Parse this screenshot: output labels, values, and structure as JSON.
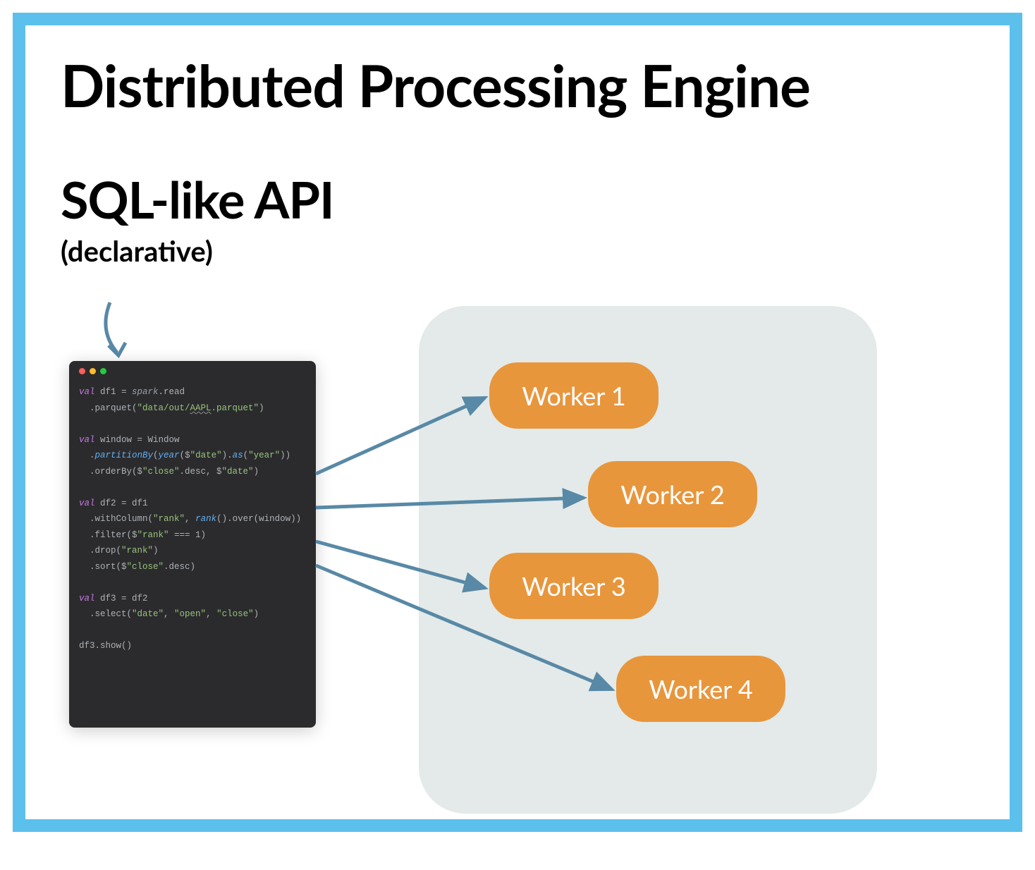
{
  "title": "Distributed Processing Engine",
  "subtitle": "SQL-like API",
  "subtitle_note": "(declarative)",
  "workers": [
    "Worker 1",
    "Worker 2",
    "Worker 3",
    "Worker 4"
  ],
  "code": {
    "l1_kw": "val",
    "l1_var": " df1 = ",
    "l1_id": "spark",
    "l1_rest": ".read",
    "l2_pre": "  .parquet(",
    "l2_str1": "\"data/out/",
    "l2_under": "AAPL",
    "l2_str2": ".parquet\"",
    "l2_post": ")",
    "l3_kw": "val",
    "l3_rest": " window = Window",
    "l4_pre": "  .",
    "l4_fn": "partitionBy",
    "l4_op": "(",
    "l4_fn2": "year",
    "l4_op2": "($",
    "l4_str": "\"date\"",
    "l4_mid": ").",
    "l4_fn3": "as",
    "l4_op3": "(",
    "l4_str2": "\"year\"",
    "l4_post": "))",
    "l5_pre": "  .orderBy($",
    "l5_str": "\"close\"",
    "l5_mid": ".desc, $",
    "l5_str2": "\"date\"",
    "l5_post": ")",
    "l6_kw": "val",
    "l6_rest": " df2 = df1",
    "l7_pre": "  .withColumn(",
    "l7_str": "\"rank\"",
    "l7_mid": ", ",
    "l7_fn": "rank",
    "l7_post": "().over(window))",
    "l8_pre": "  .filter($",
    "l8_str": "\"rank\"",
    "l8_post": " === 1)",
    "l9_pre": "  .drop(",
    "l9_str": "\"rank\"",
    "l9_post": ")",
    "l10_pre": "  .sort($",
    "l10_str": "\"close\"",
    "l10_post": ".desc)",
    "l11_kw": "val",
    "l11_rest": " df3 = df2",
    "l12_pre": "  .select(",
    "l12_s1": "\"date\"",
    "l12_c1": ", ",
    "l12_s2": "\"open\"",
    "l12_c2": ", ",
    "l12_s3": "\"close\"",
    "l12_post": ")",
    "l13": "df3.show()"
  },
  "colors": {
    "border": "#5bc0ec",
    "cluster": "#e3eae9",
    "worker": "#e8963c",
    "arrow": "#5889a6"
  }
}
